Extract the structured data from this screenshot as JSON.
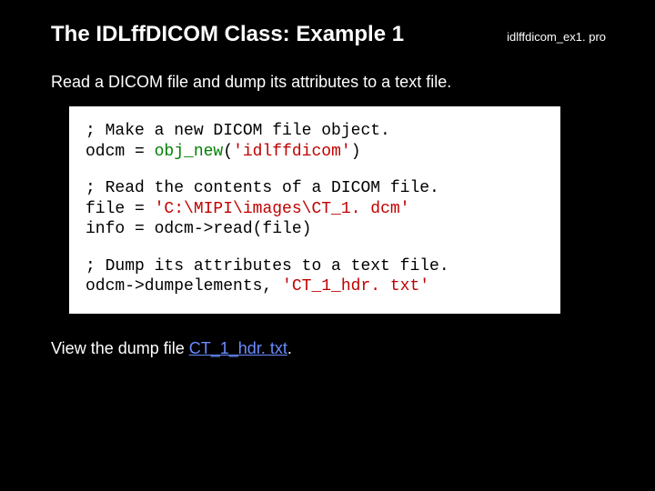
{
  "header": {
    "title": "The IDLffDICOM Class: Example 1",
    "filename": "idlffdicom_ex1. pro"
  },
  "subtitle": "Read a DICOM file and dump its attributes to a text file.",
  "code": {
    "block1": {
      "comment": "; Make a new DICOM file object.",
      "line2_pre": "odcm = ",
      "line2_fn": "obj_new",
      "line2_mid": "(",
      "line2_str": "'idlffdicom'",
      "line2_post": ")"
    },
    "block2": {
      "comment": "; Read the contents of a DICOM file.",
      "line2_pre": "file = ",
      "line2_str": "'C:\\MIPI\\images\\CT_1. dcm'",
      "line3": "info = odcm->read(file)"
    },
    "block3": {
      "comment": "; Dump its attributes to a text file.",
      "line2_pre": "odcm->dumpelements, ",
      "line2_str": "'CT_1_hdr. txt'"
    }
  },
  "footer": {
    "prefix": "View the dump file ",
    "link": "CT_1_hdr. txt",
    "suffix": "."
  }
}
